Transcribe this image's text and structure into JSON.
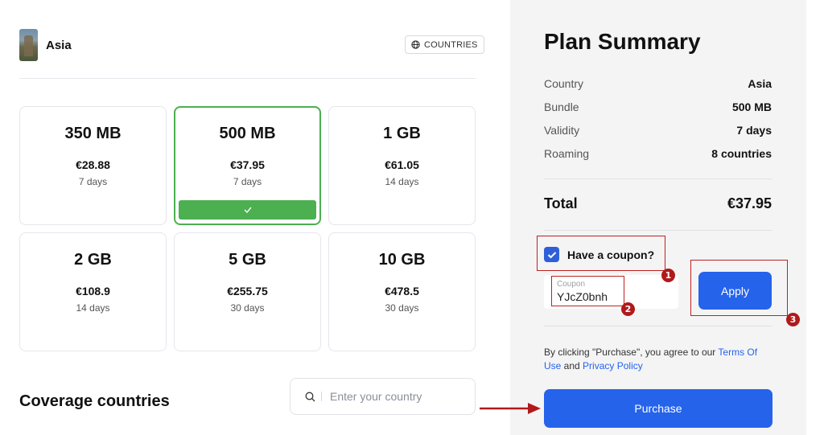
{
  "region": {
    "name": "Asia"
  },
  "countries_button": {
    "label": "COUNTRIES",
    "icon": "globe-icon"
  },
  "plans": [
    {
      "size": "350 MB",
      "price": "€28.88",
      "validity": "7 days",
      "selected": false
    },
    {
      "size": "500 MB",
      "price": "€37.95",
      "validity": "7 days",
      "selected": true
    },
    {
      "size": "1 GB",
      "price": "€61.05",
      "validity": "14 days",
      "selected": false
    },
    {
      "size": "2 GB",
      "price": "€108.9",
      "validity": "14 days",
      "selected": false
    },
    {
      "size": "5 GB",
      "price": "€255.75",
      "validity": "30 days",
      "selected": false
    },
    {
      "size": "10 GB",
      "price": "€478.5",
      "validity": "30 days",
      "selected": false
    }
  ],
  "coverage": {
    "title": "Coverage countries",
    "search_placeholder": "Enter your country"
  },
  "summary": {
    "title": "Plan Summary",
    "rows": [
      {
        "key": "Country",
        "value": "Asia"
      },
      {
        "key": "Bundle",
        "value": "500 MB"
      },
      {
        "key": "Validity",
        "value": "7 days"
      },
      {
        "key": "Roaming",
        "value": "8 countries"
      }
    ],
    "total_label": "Total",
    "total_value": "€37.95",
    "coupon_checkbox_label": "Have a coupon?",
    "coupon_checked": true,
    "coupon_field_label": "Coupon",
    "coupon_value": "YJcZ0bnh",
    "apply_label": "Apply",
    "terms_prefix": "By clicking \"Purchase\", you agree to our ",
    "terms_link": "Terms Of Use",
    "terms_and": " and ",
    "privacy_link": "Privacy Policy",
    "purchase_label": "Purchase"
  },
  "annotations": {
    "one": "1",
    "two": "2",
    "three": "3"
  },
  "colors": {
    "accent_blue": "#2563eb",
    "selected_green": "#4caf50",
    "annotation_red": "#c01f1f",
    "panel_bg": "#f4f4f5"
  }
}
